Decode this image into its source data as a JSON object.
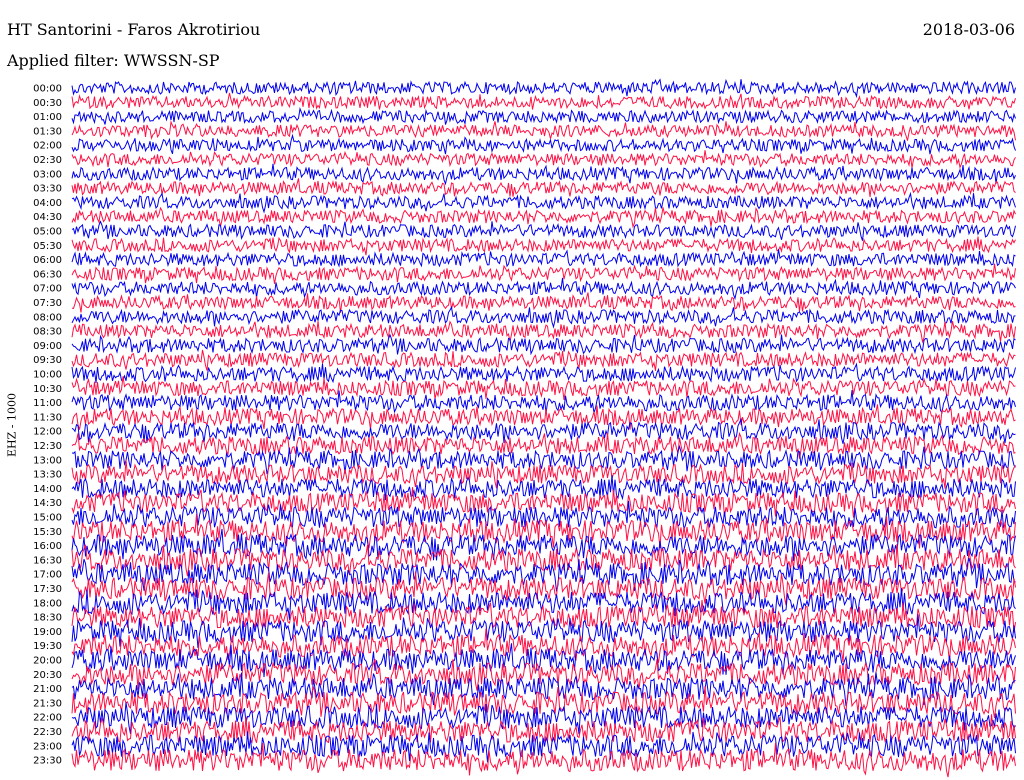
{
  "header": {
    "station": "HT Santorini - Faros Akrotiriou",
    "date": "2018-03-06",
    "filter": "Applied filter: WWSSN-SP",
    "channel": "EHZ - 1000"
  },
  "colors": {
    "odd_trace": "#0000ee",
    "even_trace": "#ff1144",
    "background": "#ffffff"
  },
  "chart_data": {
    "type": "line",
    "title": "HT Santorini - Faros Akrotiriou",
    "subtitle": "Applied filter: WWSSN-SP",
    "ylabel": "EHZ - 1000",
    "xlabel": "",
    "grid": false,
    "legend": "none",
    "categories": [
      "00:00",
      "00:30",
      "01:00",
      "01:30",
      "02:00",
      "02:30",
      "03:00",
      "03:30",
      "04:00",
      "04:30",
      "05:00",
      "05:30",
      "06:00",
      "06:30",
      "07:00",
      "07:30",
      "08:00",
      "08:30",
      "09:00",
      "09:30",
      "10:00",
      "10:30",
      "11:00",
      "11:30",
      "12:00",
      "12:30",
      "13:00",
      "13:30",
      "14:00",
      "14:30",
      "15:00",
      "15:30",
      "16:00",
      "16:30",
      "17:00",
      "17:30",
      "18:00",
      "18:30",
      "19:00",
      "19:30",
      "20:00",
      "20:30",
      "21:00",
      "21:30",
      "22:00",
      "22:30",
      "23:00",
      "23:30"
    ],
    "relative_amplitude": [
      0.55,
      0.55,
      0.55,
      0.55,
      0.55,
      0.55,
      0.58,
      0.58,
      0.58,
      0.58,
      0.58,
      0.58,
      0.6,
      0.6,
      0.6,
      0.6,
      0.62,
      0.62,
      0.65,
      0.65,
      0.68,
      0.7,
      0.72,
      0.75,
      0.78,
      0.8,
      0.82,
      0.85,
      0.88,
      0.9,
      0.95,
      1.0,
      1.0,
      1.0,
      1.0,
      1.0,
      1.0,
      1.0,
      1.0,
      1.0,
      1.0,
      1.0,
      1.0,
      1.0,
      1.0,
      1.0,
      1.0,
      1.0
    ]
  }
}
